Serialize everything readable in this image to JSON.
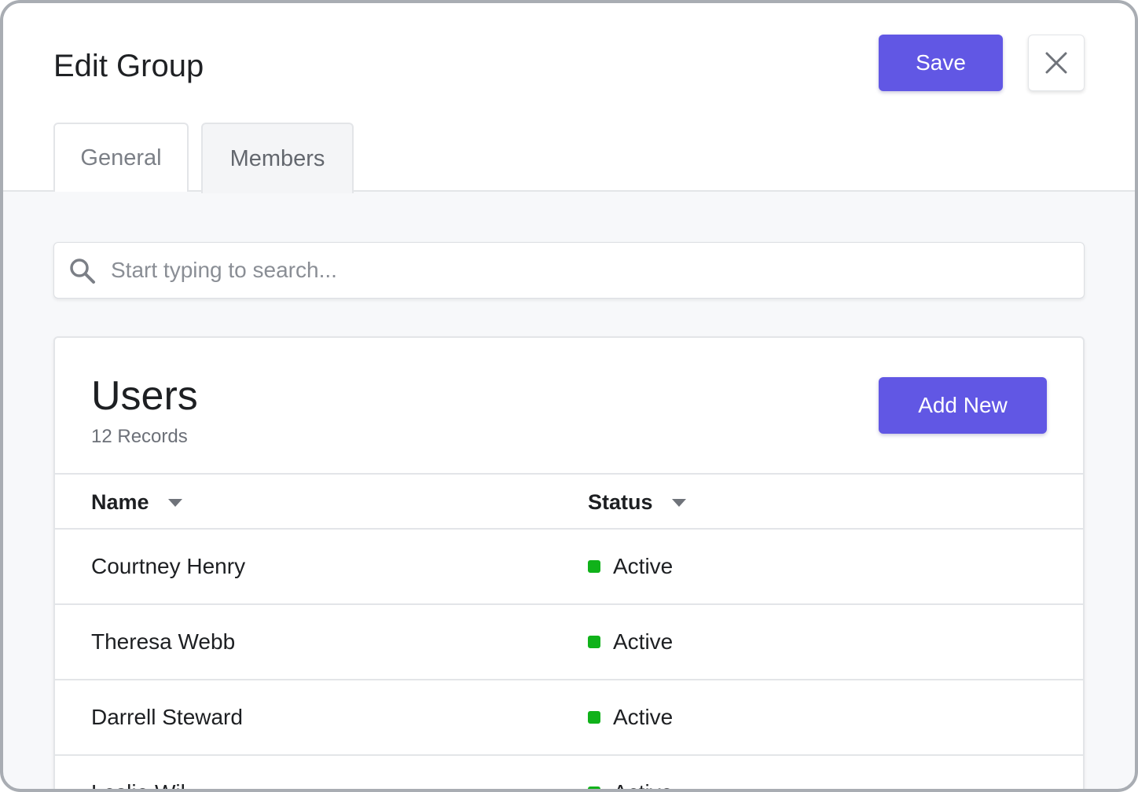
{
  "header": {
    "title": "Edit Group",
    "save_label": "Save",
    "close_icon": "close-icon"
  },
  "tabs": [
    {
      "label": "General",
      "active": false
    },
    {
      "label": "Members",
      "active": true
    }
  ],
  "search": {
    "placeholder": "Start typing to search...",
    "value": "",
    "icon": "search-icon"
  },
  "users": {
    "title": "Users",
    "count_label": "12 Records",
    "add_label": "Add New",
    "columns": [
      {
        "label": "Name",
        "icon": "caret-down-icon"
      },
      {
        "label": "Status",
        "icon": "caret-down-icon"
      }
    ],
    "rows": [
      {
        "name": "Courtney Henry",
        "status": "Active"
      },
      {
        "name": "Theresa Webb",
        "status": "Active"
      },
      {
        "name": "Darrell Steward",
        "status": "Active"
      },
      {
        "name": "Leslie Wil",
        "status": "Active"
      }
    ]
  },
  "colors": {
    "accent": "#6157e4",
    "status_active": "#10b21a",
    "border": "#a9adb3"
  }
}
